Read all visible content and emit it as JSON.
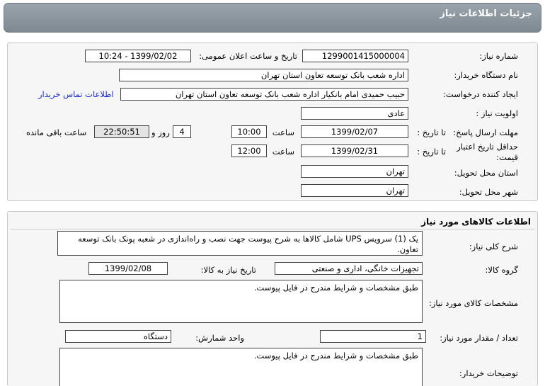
{
  "header": {
    "title": "جزئیات اطلاعات نیاز"
  },
  "info": {
    "need_number_label": "شماره نیاز:",
    "need_number": "1299001415000004",
    "announce_label": "تاریخ و ساعت اعلان عمومی:",
    "announce_value": "1399/02/02 - 10:24",
    "buyer_org_label": "نام دستگاه خریدار:",
    "buyer_org": "اداره شعب بانک توسعه تعاون استان تهران",
    "creator_label": "ایجاد کننده درخواست:",
    "creator": "حبیب حمیدی امام بانکیار اداره شعب بانک توسعه تعاون استان تهران",
    "contact_link": "اطلاعات تماس خریدار",
    "priority_label": "اولویت نیاز :",
    "priority": "عادی",
    "deadline_label": "مهلت ارسال پاسخ:",
    "to_date_label": "تا تاریخ :",
    "deadline_date": "1399/02/07",
    "time_label": "ساعت",
    "deadline_time": "10:00",
    "days": "4",
    "days_label": "روز و",
    "remaining_time": "22:50:51",
    "remaining_label": "ساعت باقی مانده",
    "min_validity_label": "حداقل تاریخ اعتبار قیمت:",
    "validity_date": "1399/02/31",
    "validity_time": "12:00",
    "province_label": "استان محل تحویل:",
    "province": "تهران",
    "city_label": "شهر محل تحویل:",
    "city": "تهران"
  },
  "goods": {
    "section_title": "اطلاعات کالاهای مورد نیاز",
    "desc_label": "شرح کلی نیاز:",
    "desc": "یک (1) سرویس UPS شامل کالاها به شرح پیوست جهت نصب و راه‌اندازی در شعبه پونک بانک توسعه تعاون.",
    "group_label": "گروه کالا:",
    "group": "تجهیزات خانگی، اداری و صنعتی",
    "need_date_label": "تاریخ نیاز به کالا:",
    "need_date": "1399/02/08",
    "specs_label": "مشخصات کالای مورد نیاز:",
    "specs": "طبق مشخصات و شرایط مندرج در فایل پیوست.",
    "qty_label": "تعداد / مقدار مورد نیاز:",
    "qty": "1",
    "unit_label": "واحد شمارش:",
    "unit": "دستگاه",
    "buyer_notes_label": "توضیحات خریدار:",
    "buyer_notes": "طبق مشخصات و شرایط مندرج در فایل پیوست."
  }
}
